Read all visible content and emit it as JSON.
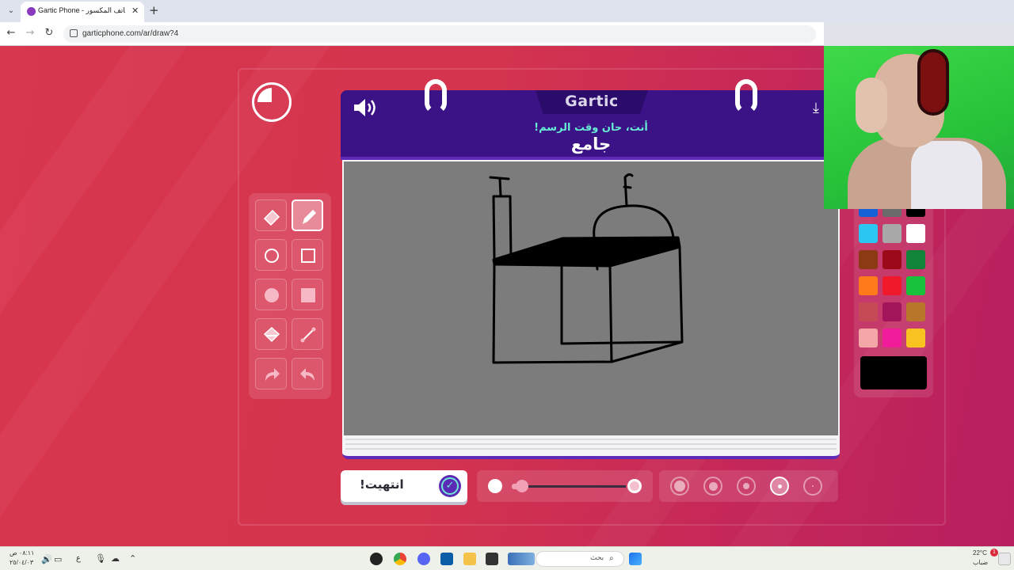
{
  "browser": {
    "tab_title": "Gartic Phone - الهاتف المكسور",
    "tab_close": "✕",
    "new_tab": "+",
    "url": "garticphone.com/ar/draw?4",
    "back": "←",
    "forward": "→",
    "reload": "↻"
  },
  "game": {
    "logo": "Gartic",
    "prompt": "أنت، حان وقت الرسم!",
    "word": "جامع",
    "done_label": "انتهيت!",
    "timer_remaining_fraction": 0.25
  },
  "palette": {
    "colors": [
      "#1761d6",
      "#6b6b6b",
      "#000000",
      "#2bc6f2",
      "#a8a8a8",
      "#ffffff",
      "#8b3a14",
      "#9b0a18",
      "#12843a",
      "#ff7a1a",
      "#f0192a",
      "#18c23a",
      "#c54a55",
      "#a3155a",
      "#b8762a",
      "#f4a7a7",
      "#f01c9a",
      "#f8c320"
    ],
    "selected": "#000000"
  },
  "brush": {
    "opacity_percent": 5,
    "sizes": [
      1,
      2,
      3,
      4,
      5
    ],
    "selected_size_index": 3
  },
  "taskbar": {
    "clock_time": "٠٨:١١ ص",
    "clock_date": "٢٥/٠٤/٠٣",
    "weather_temp": "22°C",
    "weather_label": "ضباب",
    "lang": "ع",
    "search_label": "بحث",
    "notification_count": "1"
  }
}
